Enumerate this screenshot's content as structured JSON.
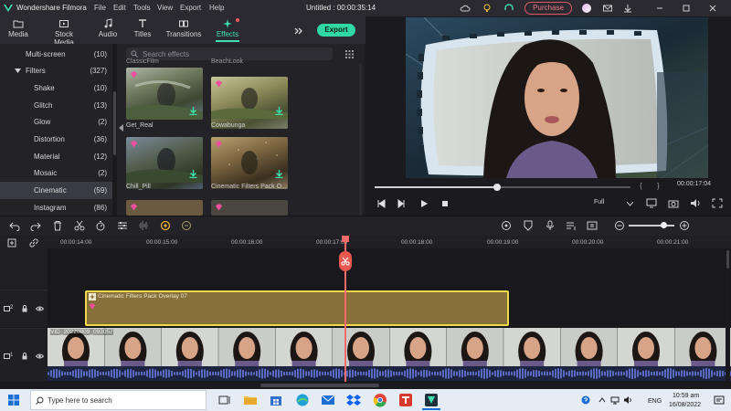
{
  "app": {
    "name": "Wondershare Filmora",
    "window_title": "Untitled : 00:00:35:14",
    "menu": [
      "File",
      "Edit",
      "Tools",
      "View",
      "Export",
      "Help"
    ],
    "purchase_label": "Purchase"
  },
  "tabs": [
    {
      "label": "Media",
      "icon": "folder-icon"
    },
    {
      "label": "Stock Media",
      "icon": "stock-media-icon"
    },
    {
      "label": "Audio",
      "icon": "music-note-icon"
    },
    {
      "label": "Titles",
      "icon": "titles-icon"
    },
    {
      "label": "Transitions",
      "icon": "transitions-icon"
    },
    {
      "label": "Effects",
      "icon": "effects-icon",
      "active": true
    }
  ],
  "export_label": "Export",
  "categories": [
    {
      "label": "Multi-screen",
      "count": "(10)",
      "indent": 1
    },
    {
      "label": "Filters",
      "count": "(327)",
      "indent": 0,
      "expanded": true
    },
    {
      "label": "Shake",
      "count": "(10)",
      "indent": 2
    },
    {
      "label": "Glitch",
      "count": "(13)",
      "indent": 2
    },
    {
      "label": "Glow",
      "count": "(2)",
      "indent": 2
    },
    {
      "label": "Distortion",
      "count": "(36)",
      "indent": 2
    },
    {
      "label": "Material",
      "count": "(12)",
      "indent": 2
    },
    {
      "label": "Mosaic",
      "count": "(2)",
      "indent": 2
    },
    {
      "label": "Cinematic",
      "count": "(59)",
      "indent": 2,
      "selected": true
    },
    {
      "label": "Instagram",
      "count": "(86)",
      "indent": 2
    }
  ],
  "search": {
    "placeholder": "Search effects"
  },
  "effects": [
    {
      "title": "ClassicFilm"
    },
    {
      "title": "BeachLook"
    },
    {
      "title": "Get_Real"
    },
    {
      "title": "Cowabunga"
    },
    {
      "title": "Chill_Pill"
    },
    {
      "title": "Cinematic Filters Pack O..."
    }
  ],
  "player": {
    "timecode": "00:00:17:04",
    "quality": "Full",
    "progress": 0.48
  },
  "ruler": [
    "00:00:14:00",
    "00:00:15:00",
    "00:00:16:00",
    "00:00:17:00",
    "00:00:18:00",
    "00:00:19:00",
    "00:00:20:00",
    "00:00:21:00"
  ],
  "tracks": {
    "fx_clip_name": "Cinematic Filters Pack Overlay 07",
    "video_clip_name": "VID_20220809_093057",
    "track2_label": "2",
    "track1_label": "1"
  },
  "taskbar": {
    "search_placeholder": "Type here to search",
    "lang": "ENG",
    "time": "10:59 am",
    "date": "16/08/2022"
  },
  "colors": {
    "accent": "#2fd8a4",
    "playhead": "#f06a6a",
    "fx_clip_border": "#f0d948",
    "purchase": "#e0566a"
  }
}
